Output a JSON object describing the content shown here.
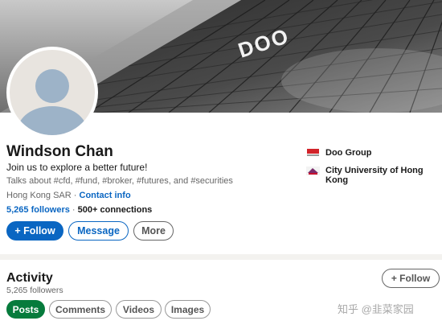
{
  "profile": {
    "name": "Windson Chan",
    "headline": "Join us to explore a better future!",
    "talks_about": "Talks about #cfd, #fund, #broker, #futures, and #securities",
    "location": "Hong Kong SAR",
    "location_separator": " · ",
    "contact_label": "Contact info",
    "followers": "5,265 followers",
    "stats_separator": " · ",
    "connections": "500+",
    "connections_suffix": " connections"
  },
  "actions": {
    "follow_label": "+ Follow",
    "message_label": "Message",
    "more_label": "More"
  },
  "companies": [
    {
      "name": "Doo Group",
      "logo_icon": "doo-group-logo-icon"
    },
    {
      "name": "City University of Hong Kong",
      "logo_icon": "cityu-logo-icon"
    }
  ],
  "cover": {
    "sign_text": "DOO"
  },
  "activity": {
    "title": "Activity",
    "followers": "5,265 followers",
    "follow_label": "+ Follow",
    "tabs": [
      {
        "label": "Posts",
        "active": true
      },
      {
        "label": "Comments",
        "active": false
      },
      {
        "label": "Videos",
        "active": false
      },
      {
        "label": "Images",
        "active": false
      }
    ]
  },
  "watermark": "知乎 @韭菜家园",
  "colors": {
    "linkedin_blue": "#0a66c2",
    "posts_green": "#067b3c",
    "doo_red": "#d2232a",
    "text_primary": "#191919",
    "text_secondary": "#666666"
  }
}
